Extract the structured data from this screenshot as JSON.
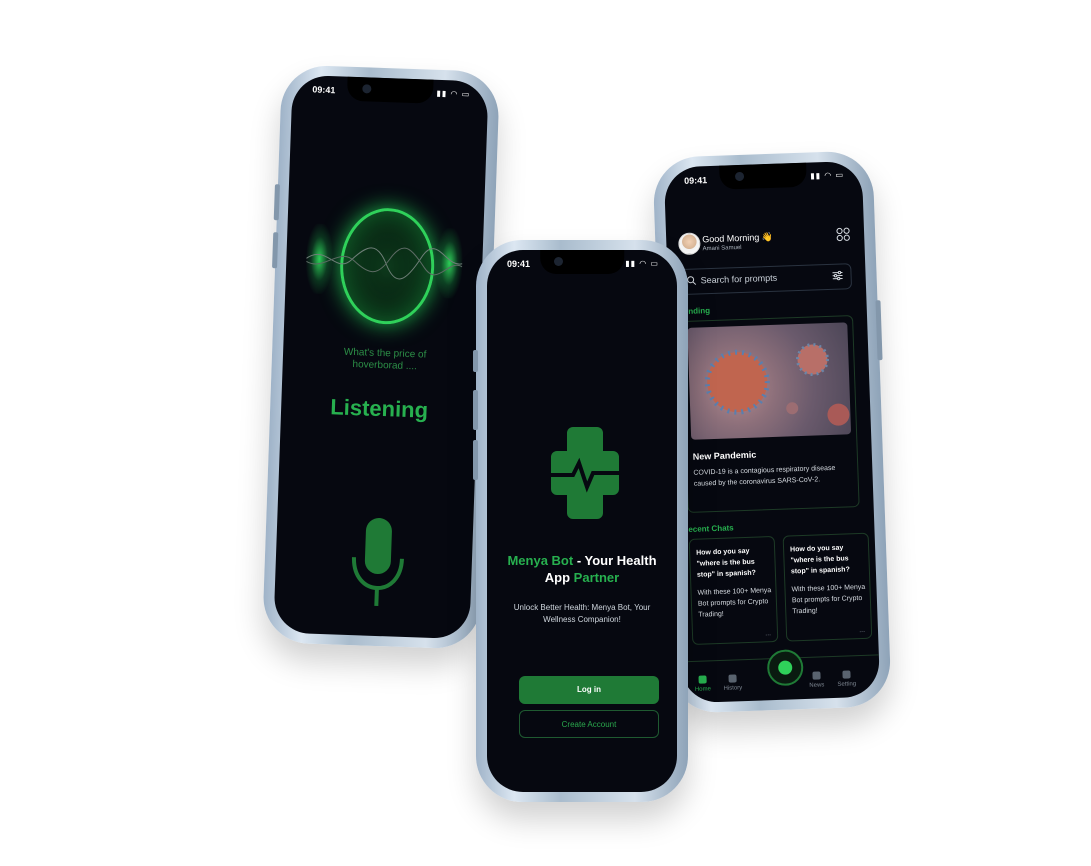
{
  "status": {
    "time": "09:41",
    "signal": "▮▮ ◠ ▭"
  },
  "voice": {
    "prompt": "What's the price of hoverborad ....",
    "state": "Listening"
  },
  "welcome": {
    "title_part1": "Menya Bot",
    "title_part2": " - Your Health App ",
    "title_part3": "Partner",
    "subtitle": "Unlock Better Health: Menya Bot, Your Wellness Companion!",
    "login_label": "Log in",
    "create_label": "Create Account"
  },
  "home": {
    "greeting": "Good Morning 👋",
    "user_name": "Amani Samuel",
    "search_placeholder": "Search for prompts",
    "trending_label": "rending",
    "card": {
      "title": "New Pandemic",
      "text": "COVID-19 is a contagious respiratory disease caused by the coronavirus SARS-CoV-2."
    },
    "recent_label": "ecent Chats",
    "chats": [
      {
        "question": "How do you say \"where is the bus stop\" in spanish?",
        "answer": "With these 100+ Menya Bot prompts for Crypto Trading!",
        "more": "..."
      },
      {
        "question": "How do you say \"where is the bus stop\" in spanish?",
        "answer": "With these 100+ Menya Bot prompts for Crypto Trading!",
        "more": "..."
      }
    ],
    "nav": [
      "Home",
      "History",
      "News",
      "Setting"
    ]
  },
  "colors": {
    "accent": "#27b04f",
    "background": "#060810",
    "button": "#1f7a36"
  }
}
